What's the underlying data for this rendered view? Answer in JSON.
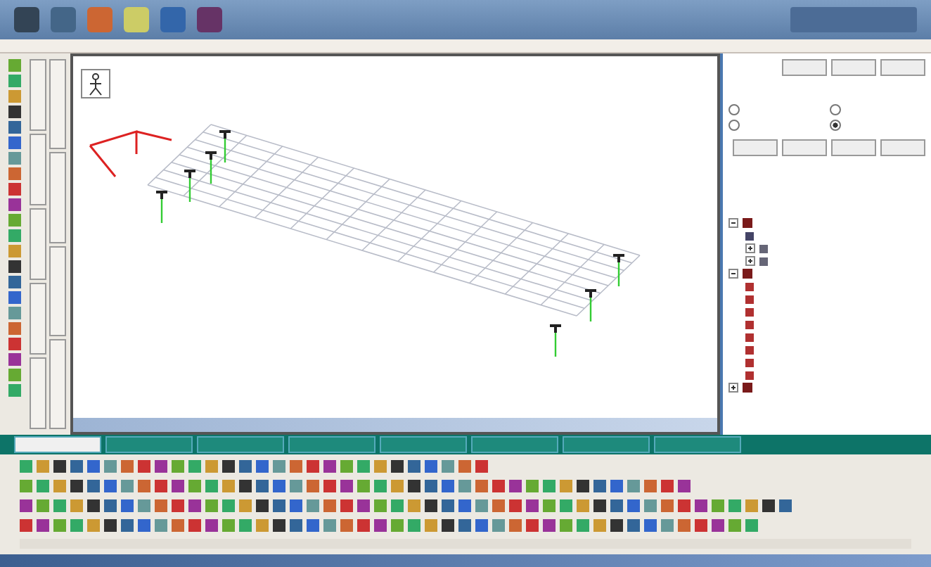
{
  "radios": [
    {
      "selected": false
    },
    {
      "selected": false
    },
    {
      "selected": false
    },
    {
      "selected": true
    }
  ],
  "bottom_tabs": [
    {
      "selected": true
    },
    {
      "selected": false
    },
    {
      "selected": false
    },
    {
      "selected": false
    },
    {
      "selected": false
    },
    {
      "selected": false
    },
    {
      "selected": false
    },
    {
      "selected": false
    }
  ],
  "tree": [
    {
      "kind": "folder",
      "expanded": true,
      "children": [
        {
          "kind": "tool"
        },
        {
          "kind": "node",
          "expanded": false
        },
        {
          "kind": "node",
          "expanded": false
        }
      ]
    },
    {
      "kind": "folder",
      "expanded": true,
      "children": [
        {
          "kind": "leaf"
        },
        {
          "kind": "leaf"
        },
        {
          "kind": "leaf"
        },
        {
          "kind": "leaf"
        },
        {
          "kind": "leaf"
        },
        {
          "kind": "leaf"
        },
        {
          "kind": "leaf"
        },
        {
          "kind": "leaf"
        }
      ]
    },
    {
      "kind": "folder",
      "expanded": false
    }
  ]
}
